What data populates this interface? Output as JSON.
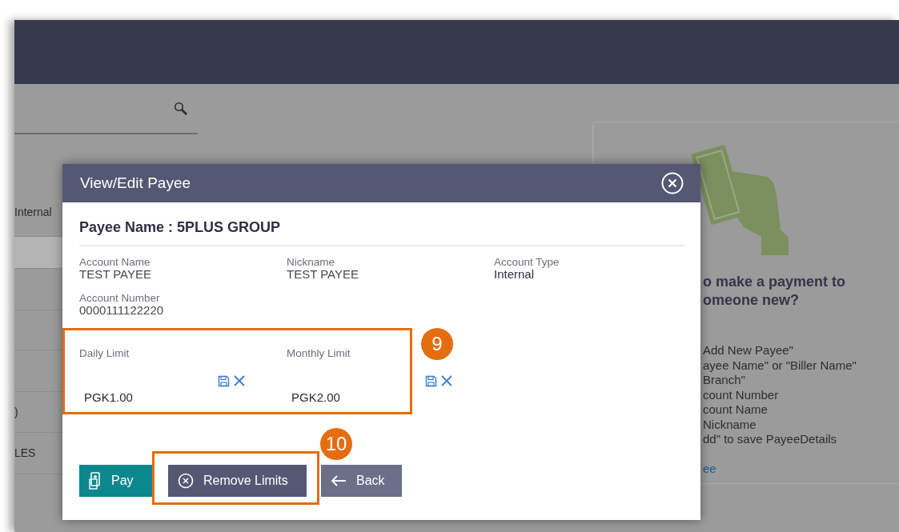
{
  "list_rows": [
    {
      "text": "Internal",
      "shaded": false
    },
    {
      "shaded": true
    },
    {
      "shaded": false
    },
    {
      "shaded": false
    },
    {
      "shaded": false
    },
    {
      "text": ")",
      "shaded": false
    },
    {
      "text": "LES",
      "shaded": false
    }
  ],
  "info_card": {
    "heading_lines": [
      "o make a payment to",
      "omeone new?"
    ],
    "steps": [
      "Add New Payee\"",
      "ayee Name\" or \"Biller Name\"",
      "Branch\"",
      "count Number",
      "count Name",
      "Nickname",
      "dd\" to save PayeeDetails"
    ],
    "link": "ee"
  },
  "modal": {
    "title": "View/Edit Payee",
    "payee_heading": "Payee Name : 5PLUS GROUP",
    "details": [
      {
        "label": "Account Name",
        "value": "TEST PAYEE"
      },
      {
        "label": "Nickname",
        "value": "TEST PAYEE"
      },
      {
        "label": "Account Type",
        "value": "Internal"
      },
      {
        "label": "Account Number",
        "value": "0000111122220"
      }
    ],
    "limits": [
      {
        "label": "Daily Limit",
        "value": "PGK1.00"
      },
      {
        "label": "Monthly Limit",
        "value": "PGK2.00"
      }
    ],
    "buttons": [
      {
        "kind": "pay",
        "label": "Pay"
      },
      {
        "kind": "remove",
        "label": "Remove Limits"
      },
      {
        "kind": "back",
        "label": "Back"
      }
    ]
  },
  "callouts": [
    {
      "label": "9"
    },
    {
      "label": "10"
    }
  ]
}
